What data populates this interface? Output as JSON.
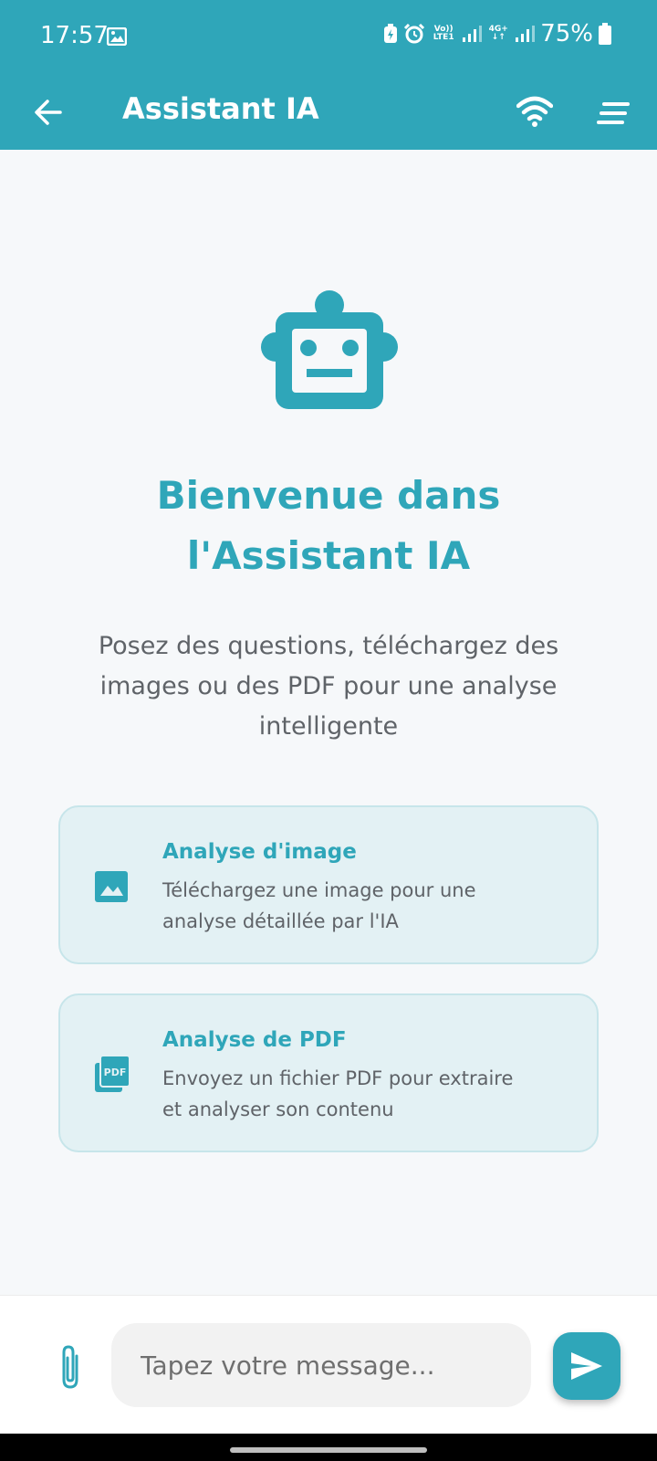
{
  "status_bar": {
    "time": "17:57",
    "battery": "75%",
    "net1_top": "Vo))",
    "net1_bottom": "LTE1",
    "net2_top": "4G+",
    "net2_bottom": "↓↑"
  },
  "app_bar": {
    "title": "Assistant IA",
    "back_icon": "arrow-back-icon",
    "wifi_icon": "wifi-icon",
    "menu_icon": "menu-icon"
  },
  "welcome": {
    "icon": "robot-icon",
    "title_line1": "Bienvenue dans",
    "title_line2": "l'Assistant IA",
    "subtitle_line1": "Posez des questions, téléchargez des",
    "subtitle_line2": "images ou des PDF pour une analyse",
    "subtitle_line3": "intelligente"
  },
  "cards": [
    {
      "icon": "image-icon",
      "title": "Analyse d'image",
      "desc_line1": "Téléchargez une image pour une",
      "desc_line2": "analyse détaillée par l'IA"
    },
    {
      "icon": "pdf-icon",
      "title": "Analyse de PDF",
      "desc_line1": "Envoyez un fichier PDF pour extraire",
      "desc_line2": "et analyser son contenu"
    }
  ],
  "composer": {
    "placeholder": "Tapez votre message...",
    "value": "",
    "attach_icon": "paperclip-icon",
    "send_icon": "send-icon"
  },
  "colors": {
    "accent": "#2fa6b9",
    "card_bg": "#e3f1f4",
    "background": "#f6f8fa"
  }
}
